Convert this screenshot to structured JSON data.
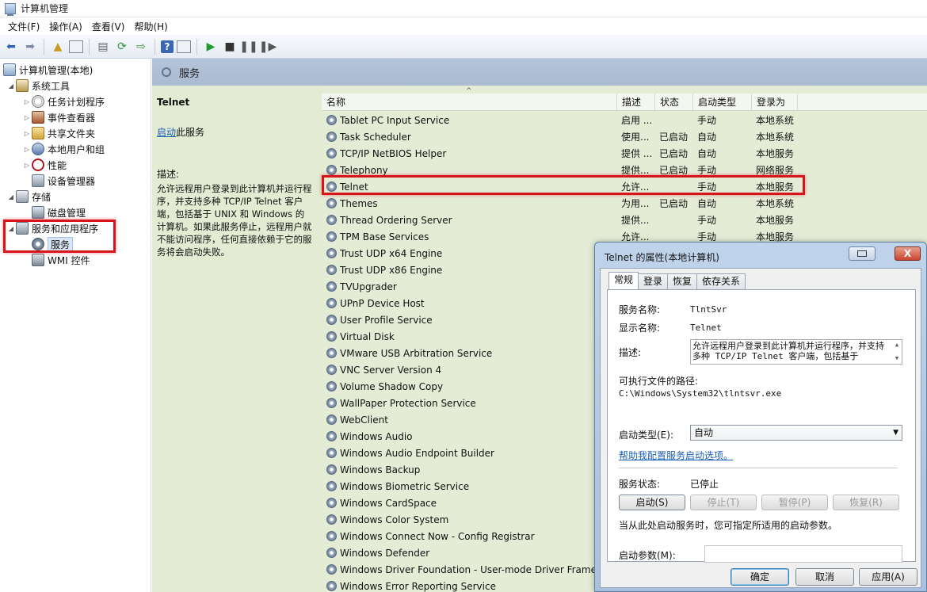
{
  "window": {
    "title": "计算机管理"
  },
  "menu": [
    "文件(F)",
    "操作(A)",
    "查看(V)",
    "帮助(H)"
  ],
  "tree": {
    "root": "计算机管理(本地)",
    "system_tools": "系统工具",
    "task_scheduler": "任务计划程序",
    "event_viewer": "事件查看器",
    "shared_folders": "共享文件夹",
    "local_users": "本地用户和组",
    "performance": "性能",
    "device_manager": "设备管理器",
    "storage": "存储",
    "disk_management": "磁盘管理",
    "services_apps": "服务和应用程序",
    "services": "服务",
    "wmi": "WMI 控件"
  },
  "main": {
    "header_title": "服务",
    "selected_service": "Telnet",
    "start_link": "启动",
    "start_suffix": "此服务",
    "desc_label": "描述:",
    "desc_text": "允许远程用户登录到此计算机并运行程序，并支持多种 TCP/IP Telnet 客户端，包括基于 UNIX 和 Windows 的计算机。如果此服务停止，远程用户就不能访问程序，任何直接依赖于它的服务将会启动失败。"
  },
  "columns": {
    "name": "名称",
    "desc": "描述",
    "status": "状态",
    "startup": "启动类型",
    "logon": "登录为"
  },
  "services": [
    {
      "name": "Tablet PC Input Service",
      "desc": "启用 ...",
      "status": "",
      "startup": "手动",
      "logon": "本地系统"
    },
    {
      "name": "Task Scheduler",
      "desc": "使用...",
      "status": "已启动",
      "startup": "自动",
      "logon": "本地系统"
    },
    {
      "name": "TCP/IP NetBIOS Helper",
      "desc": "提供 ...",
      "status": "已启动",
      "startup": "自动",
      "logon": "本地服务"
    },
    {
      "name": "Telephony",
      "desc": "提供...",
      "status": "已启动",
      "startup": "手动",
      "logon": "网络服务"
    },
    {
      "name": "Telnet",
      "desc": "允许...",
      "status": "",
      "startup": "手动",
      "logon": "本地服务"
    },
    {
      "name": "Themes",
      "desc": "为用...",
      "status": "已启动",
      "startup": "自动",
      "logon": "本地系统"
    },
    {
      "name": "Thread Ordering Server",
      "desc": "提供...",
      "status": "",
      "startup": "手动",
      "logon": "本地服务"
    },
    {
      "name": "TPM Base Services",
      "desc": "允许...",
      "status": "",
      "startup": "手动",
      "logon": "本地服务"
    },
    {
      "name": "Trust UDP x64 Engine",
      "desc": "",
      "status": "",
      "startup": "",
      "logon": ""
    },
    {
      "name": "Trust UDP x86 Engine",
      "desc": "",
      "status": "",
      "startup": "",
      "logon": ""
    },
    {
      "name": "TVUpgrader",
      "desc": "",
      "status": "",
      "startup": "",
      "logon": ""
    },
    {
      "name": "UPnP Device Host",
      "desc": "",
      "status": "",
      "startup": "",
      "logon": ""
    },
    {
      "name": "User Profile Service",
      "desc": "",
      "status": "",
      "startup": "",
      "logon": ""
    },
    {
      "name": "Virtual Disk",
      "desc": "",
      "status": "",
      "startup": "",
      "logon": ""
    },
    {
      "name": "VMware USB Arbitration Service",
      "desc": "",
      "status": "",
      "startup": "",
      "logon": ""
    },
    {
      "name": "VNC Server Version 4",
      "desc": "",
      "status": "",
      "startup": "",
      "logon": ""
    },
    {
      "name": "Volume Shadow Copy",
      "desc": "",
      "status": "",
      "startup": "",
      "logon": ""
    },
    {
      "name": "WallPaper Protection Service",
      "desc": "",
      "status": "",
      "startup": "",
      "logon": ""
    },
    {
      "name": "WebClient",
      "desc": "",
      "status": "",
      "startup": "",
      "logon": ""
    },
    {
      "name": "Windows Audio",
      "desc": "",
      "status": "",
      "startup": "",
      "logon": ""
    },
    {
      "name": "Windows Audio Endpoint Builder",
      "desc": "",
      "status": "",
      "startup": "",
      "logon": ""
    },
    {
      "name": "Windows Backup",
      "desc": "",
      "status": "",
      "startup": "",
      "logon": ""
    },
    {
      "name": "Windows Biometric Service",
      "desc": "",
      "status": "",
      "startup": "",
      "logon": ""
    },
    {
      "name": "Windows CardSpace",
      "desc": "",
      "status": "",
      "startup": "",
      "logon": ""
    },
    {
      "name": "Windows Color System",
      "desc": "",
      "status": "",
      "startup": "",
      "logon": ""
    },
    {
      "name": "Windows Connect Now - Config Registrar",
      "desc": "",
      "status": "",
      "startup": "",
      "logon": ""
    },
    {
      "name": "Windows Defender",
      "desc": "",
      "status": "",
      "startup": "",
      "logon": ""
    },
    {
      "name": "Windows Driver Foundation - User-mode Driver Framew",
      "desc": "",
      "status": "",
      "startup": "",
      "logon": ""
    },
    {
      "name": "Windows Error Reporting Service",
      "desc": "",
      "status": "",
      "startup": "",
      "logon": ""
    }
  ],
  "dialog": {
    "title": "Telnet 的属性(本地计算机)",
    "close_label": "X",
    "tabs": [
      "常规",
      "登录",
      "恢复",
      "依存关系"
    ],
    "service_name_label": "服务名称:",
    "service_name": "TlntSvr",
    "display_name_label": "显示名称:",
    "display_name": "Telnet",
    "desc_label": "描述:",
    "desc": "允许远程用户登录到此计算机并运行程序，并支持多种 TCP/IP Telnet 客户端，包括基于",
    "path_label": "可执行文件的路径:",
    "path": "C:\\Windows\\System32\\tlntsvr.exe",
    "startup_type_label": "启动类型(E):",
    "startup_type": "自动",
    "help_link": "帮助我配置服务启动选项。",
    "status_label": "服务状态:",
    "status": "已停止",
    "btn_start": "启动(S)",
    "btn_stop": "停止(T)",
    "btn_pause": "暂停(P)",
    "btn_resume": "恢复(R)",
    "param_hint": "当从此处启动服务时，您可指定所适用的启动参数。",
    "param_label": "启动参数(M):",
    "param_value": "",
    "ok": "确定",
    "cancel": "取消",
    "apply": "应用(A)"
  }
}
